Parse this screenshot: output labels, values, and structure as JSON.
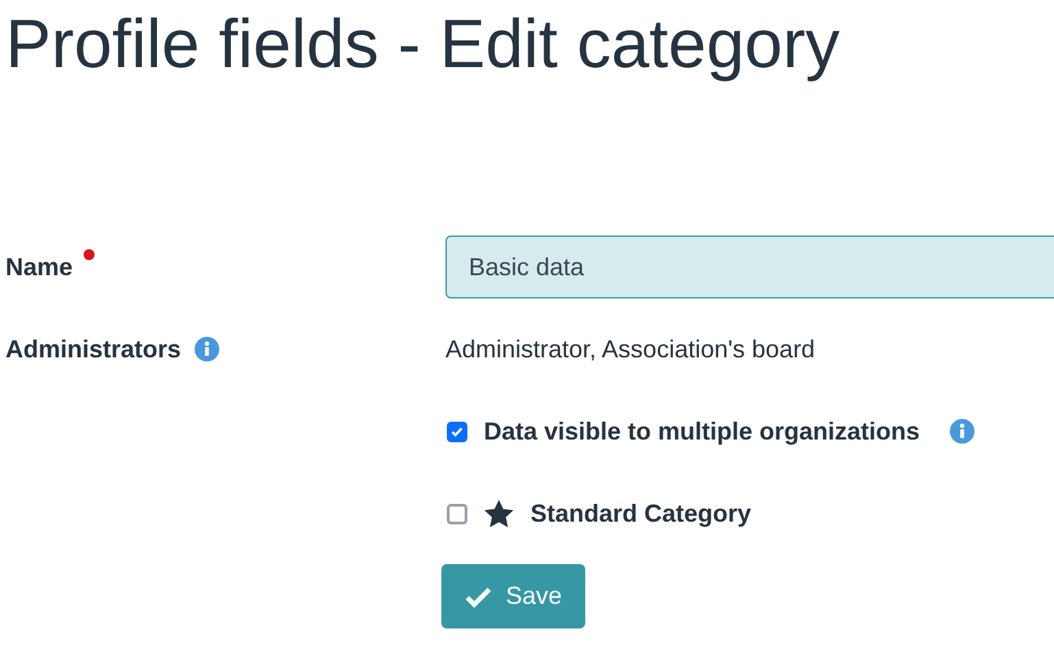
{
  "title": "Profile fields - Edit category",
  "name_field": {
    "label": "Name",
    "required": true,
    "value": "Basic data"
  },
  "administrators": {
    "label": "Administrators",
    "value": "Administrator, Association's board"
  },
  "multi_org_checkbox": {
    "label": "Data visible to multiple organizations",
    "checked": true
  },
  "standard_checkbox": {
    "label": "Standard Category",
    "checked": false
  },
  "save_button": {
    "label": "Save"
  }
}
